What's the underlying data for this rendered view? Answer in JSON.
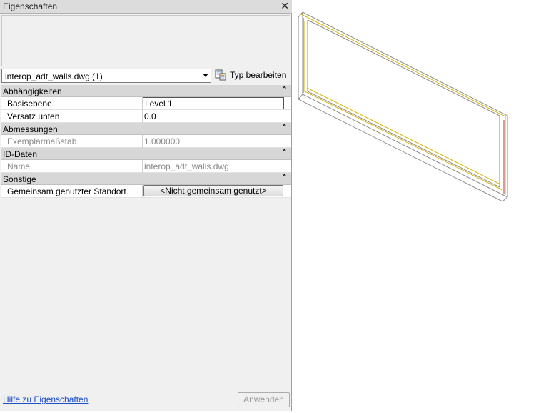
{
  "panel": {
    "title": "Eigenschaften",
    "close_symbol": "✕"
  },
  "selector": {
    "value": "interop_adt_walls.dwg (1)"
  },
  "type_button": {
    "label": "Typ bearbeiten",
    "icon": "edit-type-icon"
  },
  "categories": [
    {
      "name": "Abhängigkeiten",
      "rows": [
        {
          "key": "Basisebene",
          "value": "Level 1"
        },
        {
          "key": "Versatz unten",
          "value": "0.0"
        }
      ]
    },
    {
      "name": "Abmessungen",
      "rows": [
        {
          "key": "Exemplarmaßstab",
          "value": "1.000000"
        }
      ]
    },
    {
      "name": "ID-Daten",
      "rows": [
        {
          "key": "Name",
          "value": "interop_adt_walls.dwg"
        }
      ]
    },
    {
      "name": "Sonstige",
      "rows": [
        {
          "key": "Gemeinsam genutzter Standort",
          "value": "<Nicht gemeinsam genutzt>"
        }
      ]
    }
  ],
  "footer": {
    "help_link": "Hilfe zu Eigenschaften",
    "apply_button": "Anwenden"
  },
  "colors": {
    "accent_link": "#1a4fc9",
    "wall_edge_red": "#b83a2a",
    "wall_edge_yellow": "#d6b400",
    "wall_edge_gray": "#8a8a8a"
  }
}
